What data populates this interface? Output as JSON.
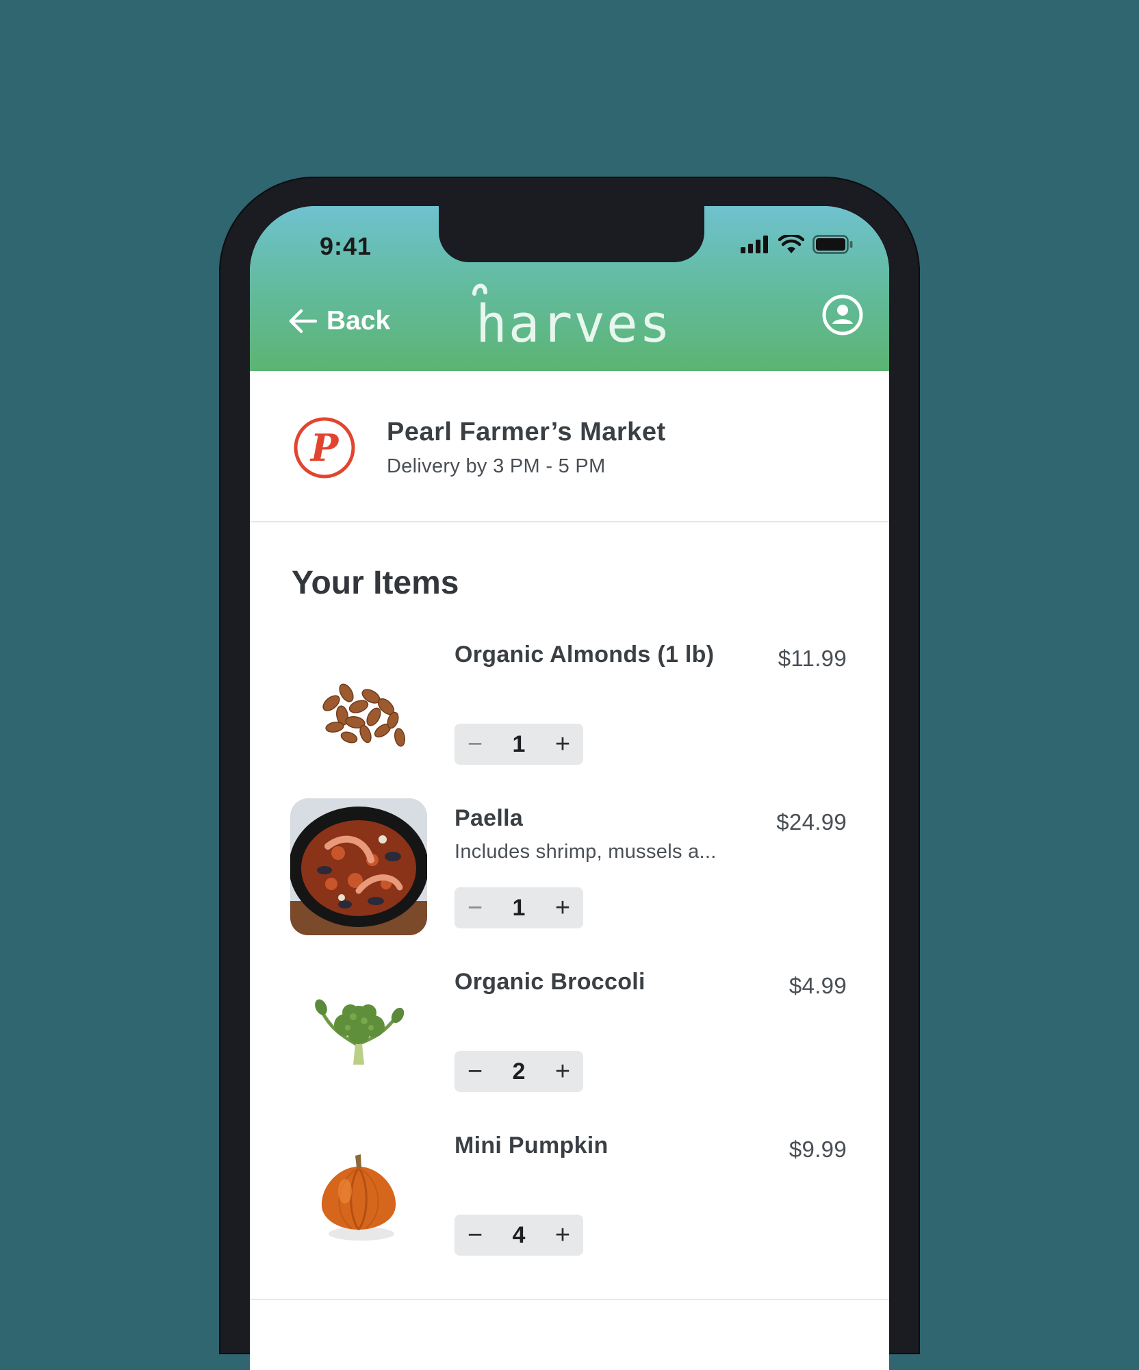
{
  "status": {
    "time": "9:41"
  },
  "header": {
    "back_label": "Back",
    "brand": "harvest"
  },
  "store": {
    "name": "Pearl Farmer’s Market",
    "delivery": "Delivery by 3 PM - 5 PM",
    "logo_letter": "P"
  },
  "section": {
    "title": "Your Items"
  },
  "items": [
    {
      "name": "Organic Almonds (1 lb)",
      "description": "",
      "price": "$11.99",
      "quantity": "1",
      "image": "almonds"
    },
    {
      "name": "Paella",
      "description": "Includes shrimp, mussels a...",
      "price": "$24.99",
      "quantity": "1",
      "image": "paella"
    },
    {
      "name": "Organic Broccoli",
      "description": "",
      "price": "$4.99",
      "quantity": "2",
      "image": "broccoli"
    },
    {
      "name": "Mini Pumpkin",
      "description": "",
      "price": "$9.99",
      "quantity": "4",
      "image": "pumpkin"
    }
  ],
  "colors": {
    "background": "#2f6670",
    "header_top": "#6fc2cf",
    "header_bottom": "#5cb473",
    "store_accent": "#e2452f"
  },
  "icons": {
    "back": "arrow-left-icon",
    "profile": "user-circle-icon",
    "signal": "cell-signal-icon",
    "wifi": "wifi-icon",
    "battery": "battery-icon",
    "minus": "minus-icon",
    "plus": "plus-icon"
  }
}
